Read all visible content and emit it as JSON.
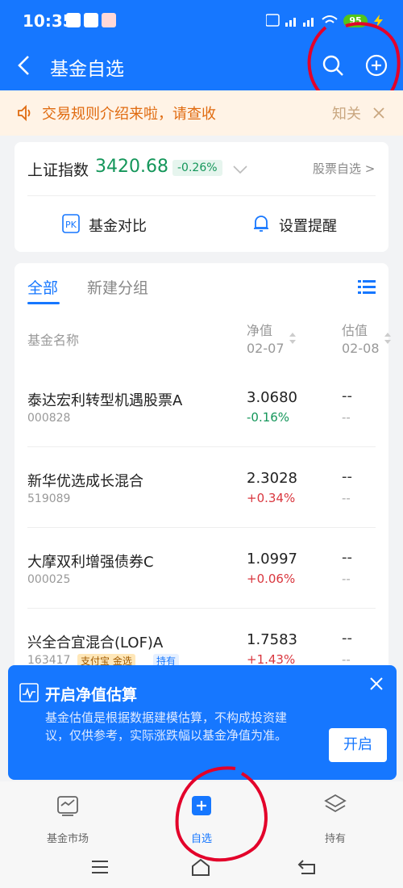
{
  "status_bar": {
    "time": "10:35",
    "battery": "95"
  },
  "header": {
    "title": "基金自选",
    "back_icon": "back-arrow-icon",
    "search_icon": "search-icon",
    "add_icon": "plus-circle-icon"
  },
  "notice": {
    "text": "交易规则介绍来啦，请查收",
    "close_text": "知关"
  },
  "index": {
    "name": "上证指数",
    "value": "3420.68",
    "change": "-0.26%",
    "stock_link": "股票自选 >"
  },
  "actions": {
    "compare": "基金对比",
    "alert": "设置提醒"
  },
  "tabs": {
    "all": "全部",
    "new_group": "新建分组"
  },
  "columns": {
    "name": "基金名称",
    "nav": "净值",
    "nav_date": "02-07",
    "est": "估值",
    "est_date": "02-08"
  },
  "funds": [
    {
      "name": "泰达宏利转型机遇股票A",
      "code": "000828",
      "nav": "3.0680",
      "change": "-0.16%",
      "est": "--",
      "est_change": "--"
    },
    {
      "name": "新华优选成长混合",
      "code": "519089",
      "nav": "2.3028",
      "change": "+0.34%",
      "est": "--",
      "est_change": "--"
    },
    {
      "name": "大摩双利增强债券C",
      "code": "000025",
      "nav": "1.0997",
      "change": "+0.06%",
      "est": "--",
      "est_change": "--"
    },
    {
      "name": "兴全合宜混合(LOF)A",
      "code": "163417",
      "nav": "1.7583",
      "change": "+1.43%",
      "est": "--",
      "est_change": "--",
      "tags": [
        "支付宝 金选",
        "持有"
      ]
    }
  ],
  "banner": {
    "title": "开启净值估算",
    "body": "基金估值是根据数据建模估算，不构成投资建议，仅供参考，实际涨跌幅以基金净值为准。",
    "button": "开启"
  },
  "tabbar": {
    "market": "基金市场",
    "watchlist": "自选",
    "holding": "持有"
  },
  "colors": {
    "primary": "#1677ff",
    "up": "#d9363e",
    "down": "#14965a",
    "notice": "#e06b10"
  }
}
